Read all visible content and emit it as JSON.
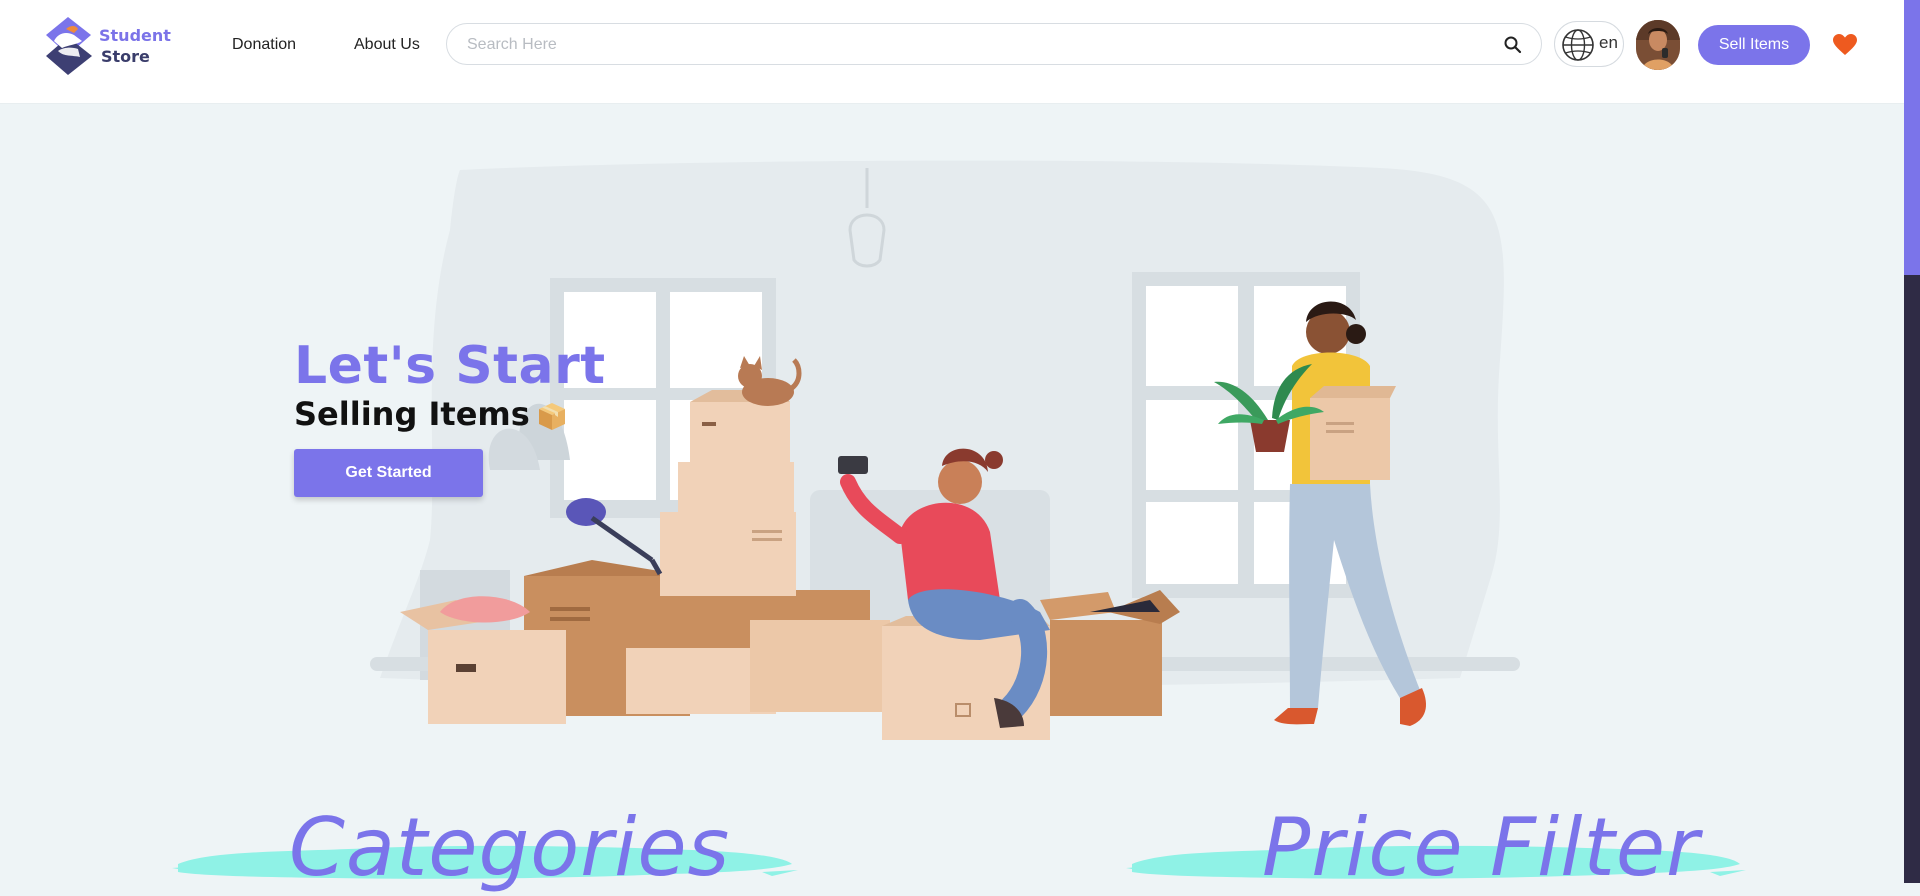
{
  "brand": {
    "name_line1": "Student",
    "name_line2": "Store"
  },
  "nav": {
    "donation": "Donation",
    "about": "About Us"
  },
  "search": {
    "placeholder": "Search Here",
    "value": ""
  },
  "language": {
    "code": "en"
  },
  "header": {
    "sell_label": "Sell Items"
  },
  "hero": {
    "title": "Let's Start",
    "subtitle": "Selling Items",
    "cta": "Get Started"
  },
  "sections": {
    "categories": "Categories",
    "price_filter": "Price Filter"
  },
  "icons": {
    "search": "search-icon",
    "globe": "globe-icon",
    "heart": "heart-icon",
    "package": "package-icon"
  },
  "colors": {
    "accent": "#7b74ea",
    "heart": "#ee5a1f",
    "brush": "#8ff2e6",
    "background": "#eef4f6",
    "scrollbar": "#2f2b45"
  }
}
